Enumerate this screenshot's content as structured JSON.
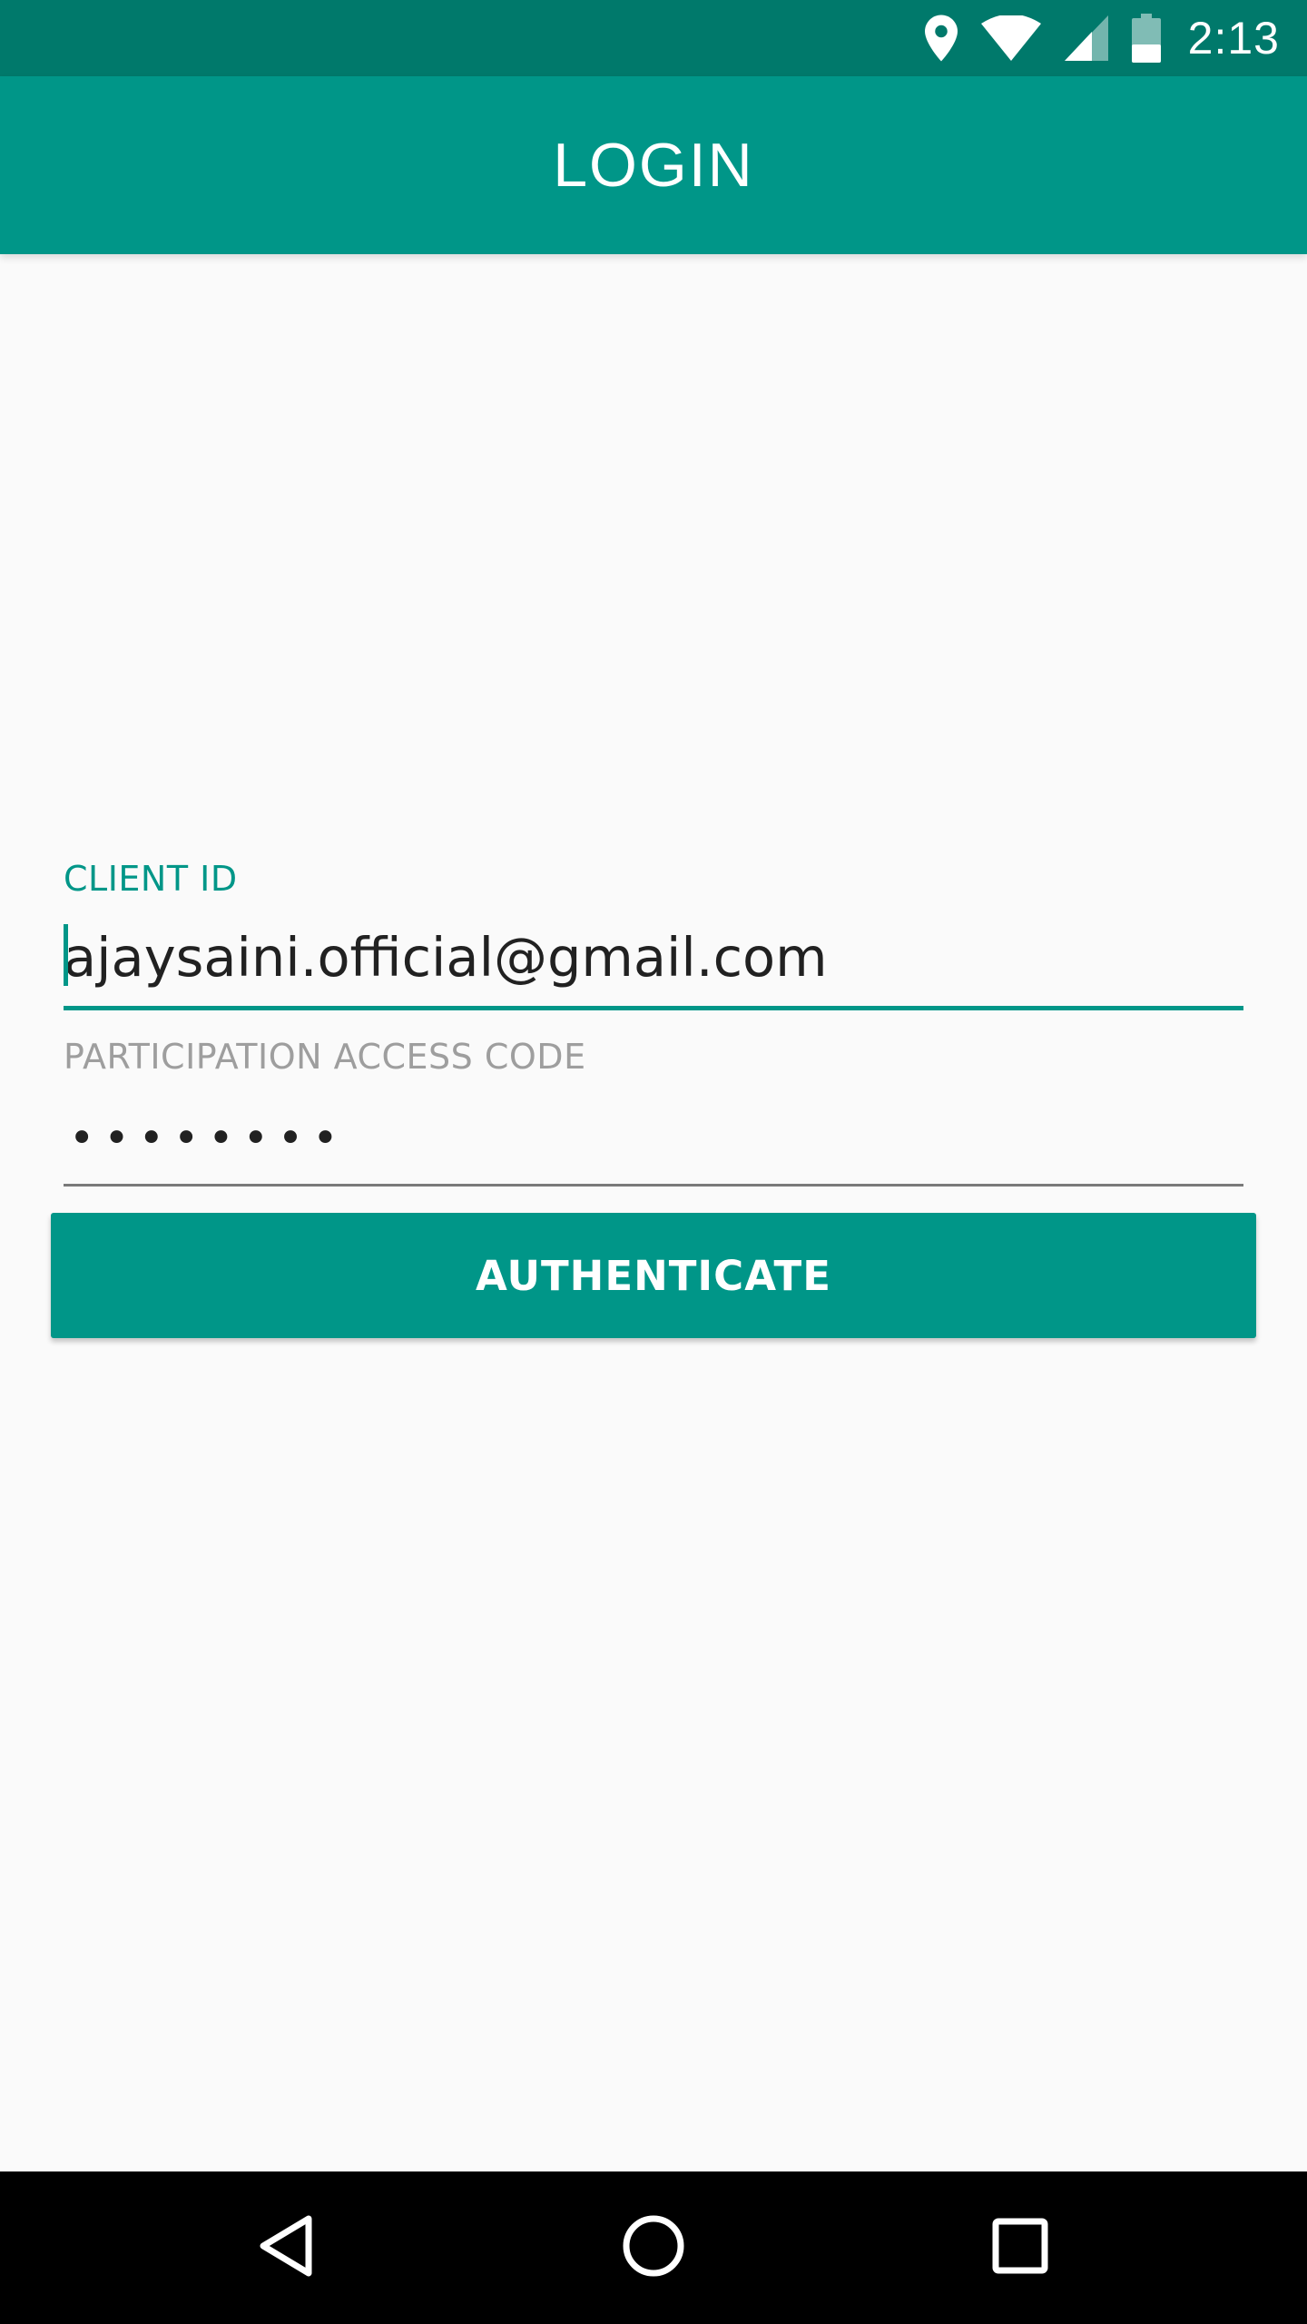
{
  "status_bar": {
    "time": "2:13",
    "icons": [
      "location-icon",
      "wifi-icon",
      "signal-icon",
      "battery-icon"
    ]
  },
  "app_bar": {
    "title": "LOGIN"
  },
  "form": {
    "client_id": {
      "label": "CLIENT ID",
      "value": "ajaysaini.official@gmail.com"
    },
    "access_code": {
      "label": "PARTICIPATION ACCESS CODE",
      "value": "••••••••"
    },
    "submit_label": "AUTHENTICATE"
  },
  "nav_bar": {
    "buttons": [
      "back-icon",
      "home-icon",
      "recents-icon"
    ]
  },
  "colors": {
    "primary": "#009688",
    "primary_dark": "#00796B",
    "background": "#FAFAFA",
    "label_inactive": "#9E9E9E",
    "text": "#212121"
  }
}
